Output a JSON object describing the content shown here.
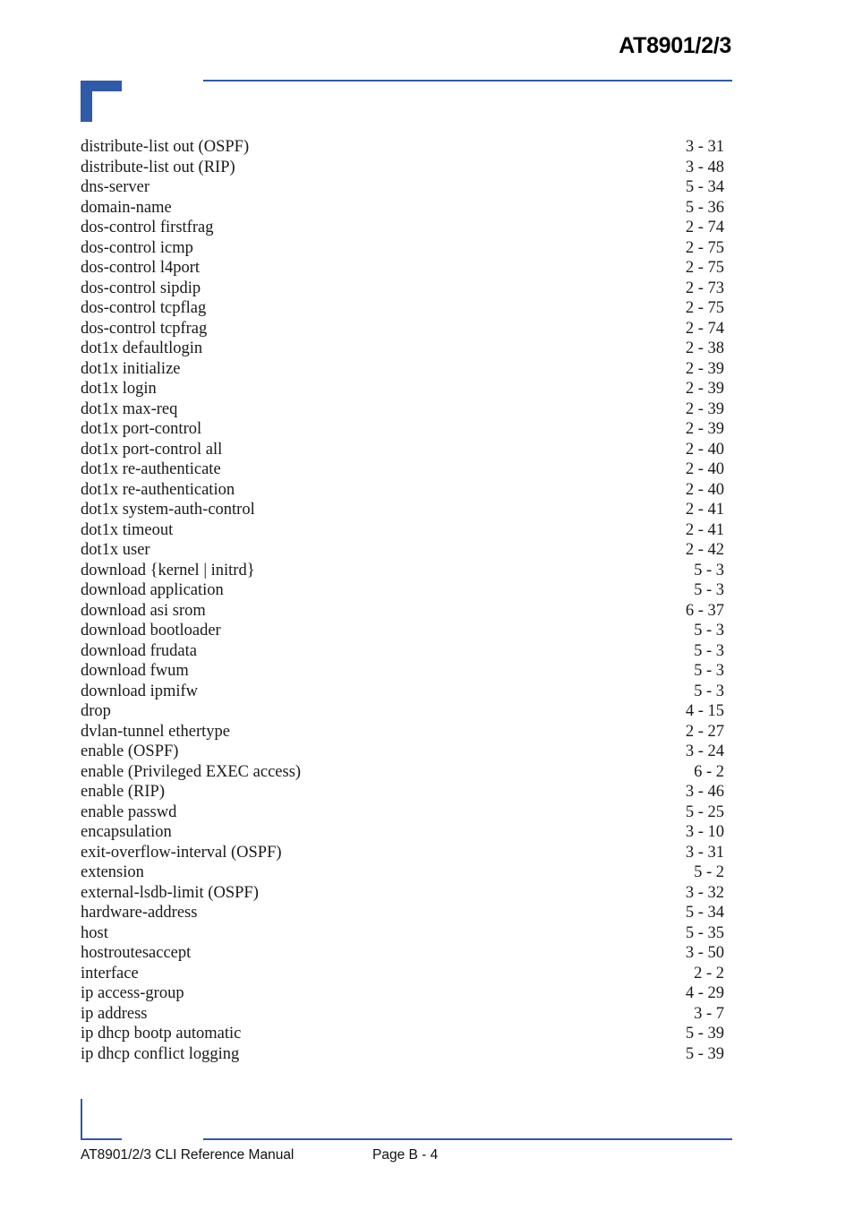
{
  "header": {
    "title": "AT8901/2/3"
  },
  "index_entries": [
    {
      "term": "distribute-list out (OSPF)",
      "page": "3 - 31"
    },
    {
      "term": "distribute-list out (RIP)",
      "page": "3 - 48"
    },
    {
      "term": "dns-server",
      "page": "5 - 34"
    },
    {
      "term": "domain-name",
      "page": "5 - 36"
    },
    {
      "term": "dos-control firstfrag",
      "page": "2 - 74"
    },
    {
      "term": "dos-control icmp",
      "page": "2 - 75"
    },
    {
      "term": "dos-control l4port",
      "page": "2 - 75"
    },
    {
      "term": "dos-control sipdip",
      "page": "2 - 73"
    },
    {
      "term": "dos-control tcpflag",
      "page": "2 - 75"
    },
    {
      "term": "dos-control tcpfrag",
      "page": "2 - 74"
    },
    {
      "term": "dot1x defaultlogin",
      "page": "2 - 38"
    },
    {
      "term": "dot1x initialize",
      "page": "2 - 39"
    },
    {
      "term": "dot1x login",
      "page": "2 - 39"
    },
    {
      "term": "dot1x max-req",
      "page": "2 - 39"
    },
    {
      "term": "dot1x port-control",
      "page": "2 - 39"
    },
    {
      "term": "dot1x port-control all",
      "page": "2 - 40"
    },
    {
      "term": "dot1x re-authenticate",
      "page": "2 - 40"
    },
    {
      "term": "dot1x re-authentication",
      "page": "2 - 40"
    },
    {
      "term": "dot1x system-auth-control",
      "page": "2 - 41"
    },
    {
      "term": "dot1x timeout",
      "page": "2 - 41"
    },
    {
      "term": "dot1x user",
      "page": "2 - 42"
    },
    {
      "term": "download {kernel | initrd}",
      "page": "5 - 3"
    },
    {
      "term": "download application",
      "page": "5 - 3"
    },
    {
      "term": "download asi srom",
      "page": "6 - 37"
    },
    {
      "term": "download bootloader",
      "page": "5 - 3"
    },
    {
      "term": "download frudata",
      "page": "5 - 3"
    },
    {
      "term": "download fwum",
      "page": "5 - 3"
    },
    {
      "term": "download ipmifw",
      "page": "5 - 3"
    },
    {
      "term": "drop",
      "page": "4 - 15"
    },
    {
      "term": "dvlan-tunnel ethertype",
      "page": "2 - 27"
    },
    {
      "term": "enable (OSPF)",
      "page": "3 - 24"
    },
    {
      "term": "enable (Privileged EXEC access)",
      "page": "6 - 2"
    },
    {
      "term": "enable (RIP)",
      "page": "3 - 46"
    },
    {
      "term": "enable passwd",
      "page": "5 - 25"
    },
    {
      "term": "encapsulation",
      "page": "3 - 10"
    },
    {
      "term": "exit-overflow-interval (OSPF)",
      "page": "3 - 31"
    },
    {
      "term": "extension",
      "page": "5 - 2"
    },
    {
      "term": "external-lsdb-limit (OSPF)",
      "page": "3 - 32"
    },
    {
      "term": "hardware-address",
      "page": "5 - 34"
    },
    {
      "term": "host",
      "page": "5 - 35"
    },
    {
      "term": "hostroutesaccept",
      "page": "3 - 50"
    },
    {
      "term": "interface",
      "page": "2 - 2"
    },
    {
      "term": "ip access-group",
      "page": "4 - 29"
    },
    {
      "term": "ip address",
      "page": "3 - 7"
    },
    {
      "term": "ip dhcp bootp automatic",
      "page": "5 - 39"
    },
    {
      "term": "ip dhcp conflict logging",
      "page": "5 - 39"
    }
  ],
  "footer": {
    "manual_title": "AT8901/2/3 CLI Reference Manual",
    "page_label": "Page B - 4"
  },
  "colors": {
    "accent": "#2f5aa8"
  }
}
